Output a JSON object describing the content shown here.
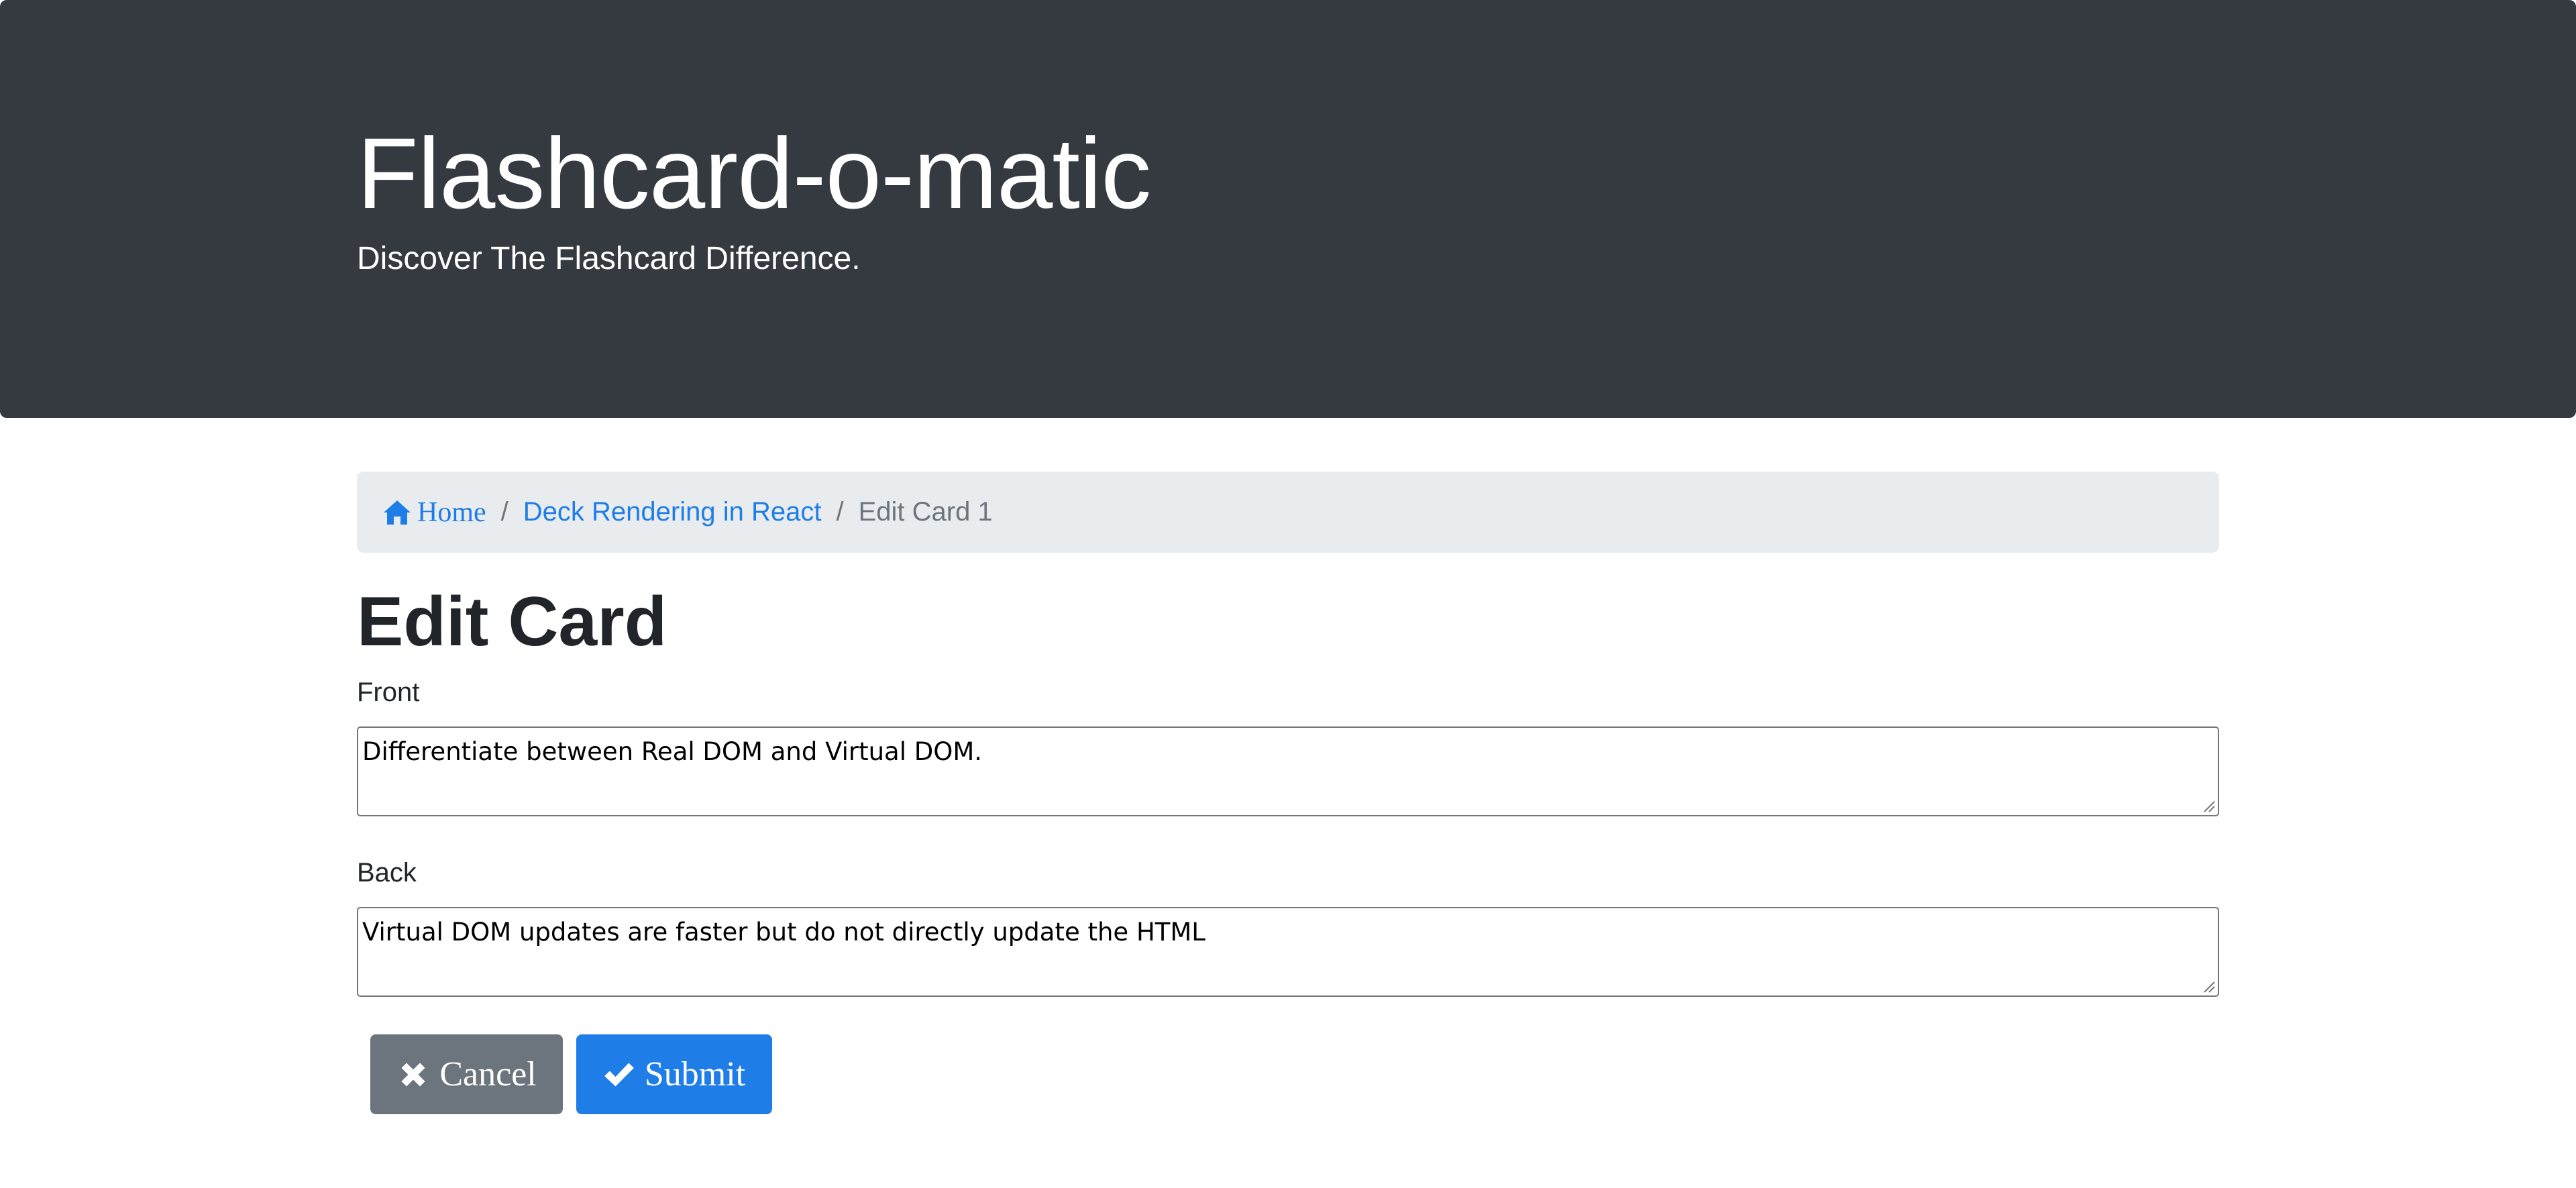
{
  "header": {
    "title": "Flashcard-o-matic",
    "tagline": "Discover The Flashcard Difference."
  },
  "breadcrumb": {
    "home_label": "Home",
    "home_icon": "home-icon",
    "deck_label": "Deck Rendering in React",
    "separator": "/",
    "current_label": "Edit Card 1"
  },
  "page": {
    "title": "Edit Card"
  },
  "form": {
    "front_label": "Front",
    "front_value": "Differentiate between Real DOM and Virtual DOM.",
    "back_label": "Back",
    "back_value": "Virtual DOM updates are faster but do not directly update the HTML"
  },
  "actions": {
    "cancel_label": "Cancel",
    "cancel_icon": "x-icon",
    "submit_label": "Submit",
    "submit_icon": "check-icon"
  },
  "colors": {
    "header_bg": "#343a40",
    "breadcrumb_bg": "#e9ecef",
    "link": "#1f7de8",
    "cancel_bg": "#6c757d",
    "submit_bg": "#1f7de8"
  }
}
